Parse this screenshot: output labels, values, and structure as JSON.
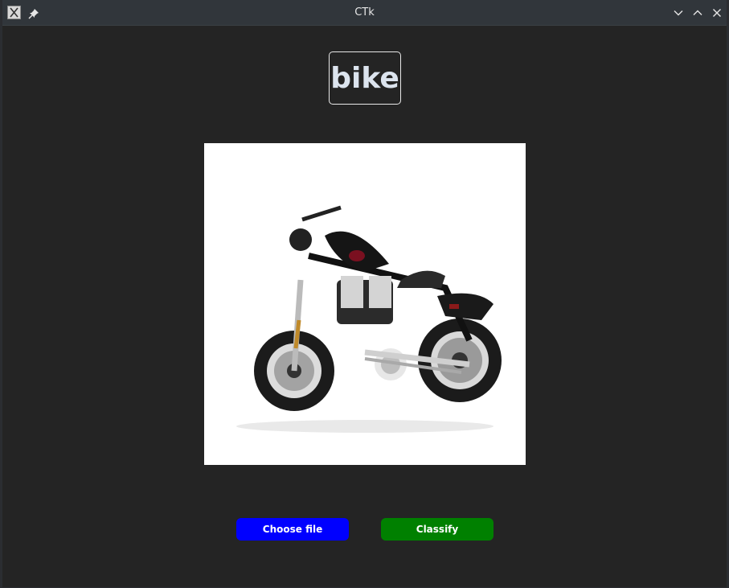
{
  "window": {
    "title": "CTk"
  },
  "icons": {
    "app": "x-app-icon",
    "pin": "pin-icon",
    "minimize": "chevron-down-icon",
    "maximize": "chevron-up-icon",
    "close": "close-icon"
  },
  "result": {
    "label": "bike"
  },
  "image": {
    "subject": "motorcycle"
  },
  "buttons": {
    "choose_file": "Choose file",
    "classify": "Classify"
  },
  "colors": {
    "window_bg": "#242424",
    "titlebar_bg": "#31363b",
    "choose_button": "#0000ff",
    "classify_button": "#008000",
    "result_text": "#dce4ee"
  }
}
